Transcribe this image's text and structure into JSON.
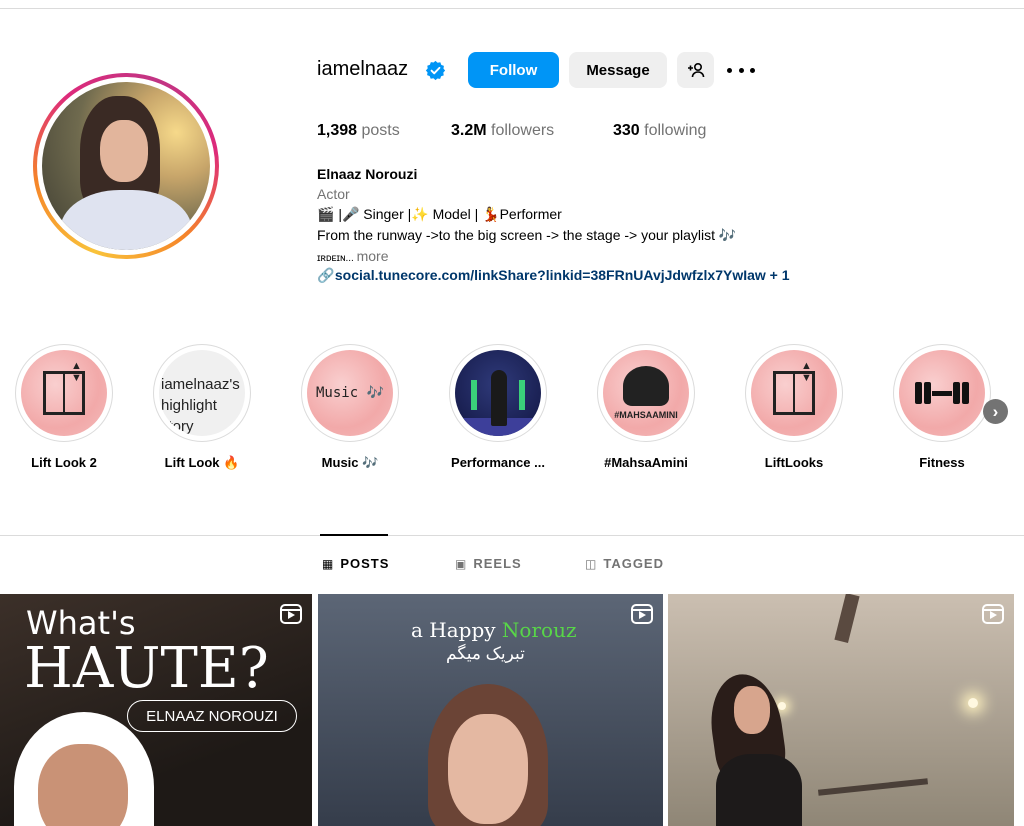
{
  "profile": {
    "username": "iamelnaaz",
    "verified": true,
    "follow_label": "Follow",
    "message_label": "Message",
    "stats": {
      "posts_count": "1,398",
      "posts_label": "posts",
      "followers_count": "3.2M",
      "followers_label": "followers",
      "following_count": "330",
      "following_label": "following"
    },
    "bio": {
      "name": "Elnaaz Norouzi",
      "category": "Actor",
      "line1": "🎬 |🎤 Singer |✨ Model | 💃Performer",
      "line2": "From the runway ->to the big screen -> the stage -> your playlist 🎶",
      "line3": "ɪʀᴅᴇɪɴ...",
      "more_label": "more",
      "link": "social.tunecore.com/linkShare?linkid=38FRnUAvjJdwfzlx7YwIaw + 1"
    }
  },
  "highlights": [
    {
      "label": "Lift Look 2"
    },
    {
      "label": "Lift Look 🔥",
      "cover_text": "iamelnaaz's highlight story"
    },
    {
      "label": "Music 🎶",
      "cover_text": "Music 🎶"
    },
    {
      "label": "Performance ..."
    },
    {
      "label": "#MahsaAmini",
      "cover_text": "#MAHSAAMINI"
    },
    {
      "label": "LiftLooks"
    },
    {
      "label": "Fitness"
    }
  ],
  "tabs": {
    "posts": "POSTS",
    "reels": "REELS",
    "tagged": "TAGGED"
  },
  "posts": [
    {
      "line1": "What's",
      "line2": "HAUTE?",
      "name_tag": "ELNAAZ NOROUZI"
    },
    {
      "title_prefix": "a Happy",
      "title_highlight": "Norouz",
      "subtitle": "تبریک میگم"
    },
    {}
  ],
  "colors": {
    "follow_button": "#0095f6",
    "link": "#00376b",
    "secondary_text": "#737373"
  }
}
